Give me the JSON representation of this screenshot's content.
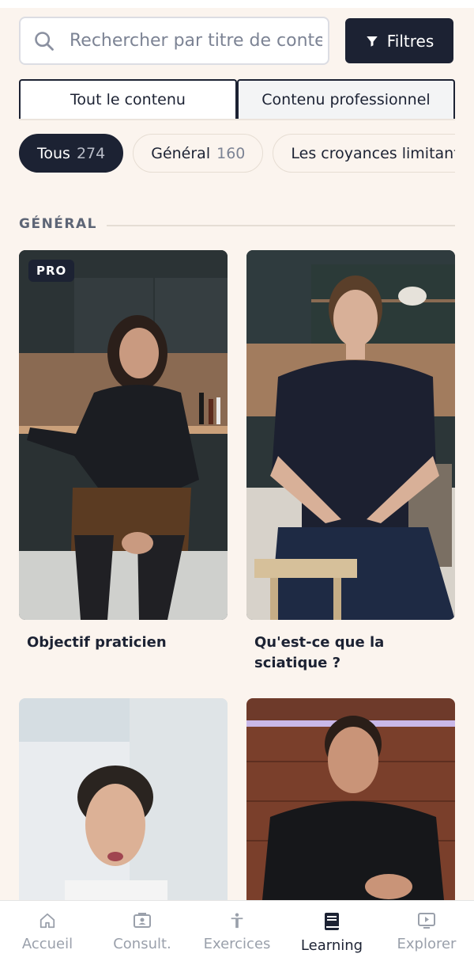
{
  "search": {
    "placeholder": "Rechercher par titre de contenu"
  },
  "filter_button": {
    "label": "Filtres",
    "icon": "filter-icon"
  },
  "segments": [
    {
      "label": "Tout le contenu",
      "active": true
    },
    {
      "label": "Contenu professionnel",
      "active": false
    }
  ],
  "chips": [
    {
      "label": "Tous",
      "count": "274",
      "active": true
    },
    {
      "label": "Général",
      "count": "160",
      "active": false
    },
    {
      "label": "Les croyances limitantes",
      "count": "",
      "active": false
    }
  ],
  "section": {
    "title": "GÉNÉRAL"
  },
  "cards": [
    {
      "title": "Objectif praticien",
      "badge": "PRO"
    },
    {
      "title": "Qu'est-ce que la sciatique ?",
      "badge": ""
    },
    {
      "title": "",
      "badge": ""
    },
    {
      "title": "",
      "badge": ""
    }
  ],
  "nav": [
    {
      "label": "Accueil",
      "icon": "home-icon",
      "active": false
    },
    {
      "label": "Consult.",
      "icon": "contact-card-icon",
      "active": false
    },
    {
      "label": "Exercices",
      "icon": "person-exercise-icon",
      "active": false
    },
    {
      "label": "Learning",
      "icon": "book-icon",
      "active": true
    },
    {
      "label": "Explorer",
      "icon": "play-screen-icon",
      "active": false
    }
  ],
  "colors": {
    "primary": "#1c2233",
    "background": "#fbf4ee",
    "muted": "#9aa0ab"
  }
}
